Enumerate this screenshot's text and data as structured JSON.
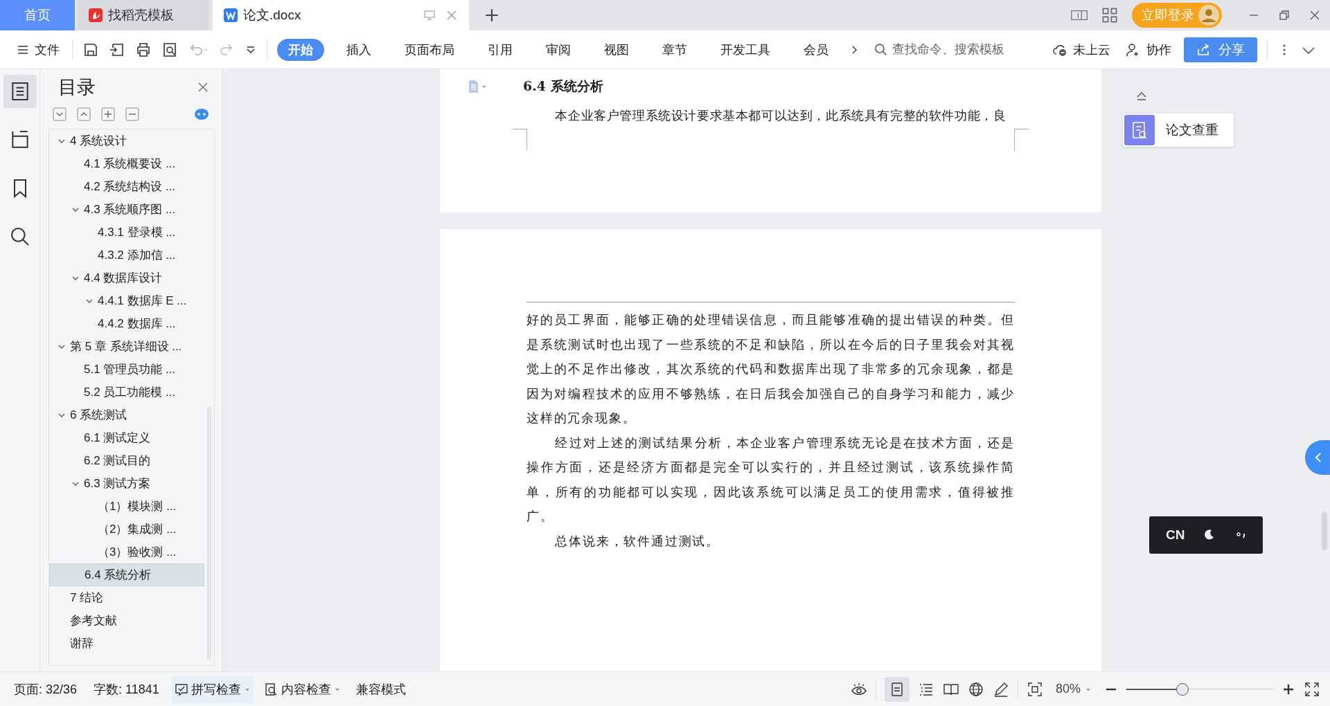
{
  "tabs": [
    {
      "label": "首页",
      "kind": "home",
      "selected": false
    },
    {
      "label": "找稻壳模板",
      "kind": "docer",
      "selected": false
    },
    {
      "label": "论文.docx",
      "kind": "doc",
      "selected": true
    }
  ],
  "account": {
    "login": "立即登录"
  },
  "toolbar": {
    "file_menu": "文件",
    "ribbon_tabs": [
      {
        "label": "开始",
        "selected": true
      },
      {
        "label": "插入",
        "selected": false
      },
      {
        "label": "页面布局",
        "selected": false
      },
      {
        "label": "引用",
        "selected": false
      },
      {
        "label": "审阅",
        "selected": false
      },
      {
        "label": "视图",
        "selected": false
      },
      {
        "label": "章节",
        "selected": false
      },
      {
        "label": "开发工具",
        "selected": false
      },
      {
        "label": "会员",
        "selected": false
      }
    ],
    "search": {
      "placeholder": "查找命令、搜索模板"
    },
    "cloud": "未上云",
    "collaborate": "协作",
    "share": "分享"
  },
  "sidebar": {
    "title": "目录",
    "outline": [
      {
        "label": "4  系统设计",
        "expanded": true,
        "selected": false,
        "children": [
          {
            "label": "4.1 系统概要设 ...",
            "selected": false
          },
          {
            "label": "4.2 系统结构设 ...",
            "selected": false
          },
          {
            "label": "4.3 系统顺序图 ...",
            "expanded": true,
            "selected": false,
            "children": [
              {
                "label": "4.3.1 登录模 ...",
                "selected": false
              },
              {
                "label": "4.3.2 添加信 ...",
                "selected": false
              }
            ]
          },
          {
            "label": "4.4 数据库设计",
            "expanded": true,
            "selected": false,
            "children": [
              {
                "label": "4.4.1 数据库 E ...",
                "expanded": true,
                "selected": false
              },
              {
                "label": "4.4.2 数据库 ...",
                "selected": false
              }
            ]
          }
        ]
      },
      {
        "label": "第 5 章  系统详细设 ...",
        "expanded": true,
        "selected": false,
        "children": [
          {
            "label": "5.1 管理员功能 ...",
            "selected": false
          },
          {
            "label": "5.2 员工功能模 ...",
            "selected": false
          }
        ]
      },
      {
        "label": "6  系统测试",
        "expanded": true,
        "selected": false,
        "children": [
          {
            "label": "6.1  测试定义",
            "selected": false
          },
          {
            "label": "6.2  测试目的",
            "selected": false
          },
          {
            "label": "6.3 测试方案",
            "expanded": true,
            "selected": false,
            "children": [
              {
                "label": "（1）模块测 ...",
                "selected": false
              },
              {
                "label": "（2）集成测 ...",
                "selected": false
              },
              {
                "label": "（3）验收测 ...",
                "selected": false
              }
            ]
          },
          {
            "label": "6.4 系统分析",
            "selected": true
          }
        ]
      },
      {
        "label": "7  结论",
        "selected": false
      },
      {
        "label": "参考文献",
        "selected": false
      },
      {
        "label": "谢辞",
        "selected": false
      }
    ]
  },
  "document": {
    "pages": [
      {
        "heading": "6.4 系统分析",
        "paragraphs": [
          {
            "indent": true,
            "text": "本企业客户管理系统设计要求基本都可以达到，此系统具有完整的软件功能，良"
          }
        ]
      },
      {
        "paragraphs": [
          {
            "indent": false,
            "text": "好的员工界面，能够正确的处理错误信息，而且能够准确的提出错误的种类。但是系统测试时也出现了一些系统的不足和缺陷，所以在今后的日子里我会对其视觉上的不足作出修改，其次系统的代码和数据库出现了非常多的冗余现象，都是因为对编程技术的应用不够熟练，在日后我会加强自己的自身学习和能力，减少这样的冗余现象。"
          },
          {
            "indent": true,
            "text": "经过对上述的测试结果分析，本企业客户管理系统无论是在技术方面，还是操作方面，还是经济方面都是完全可以实行的，并且经过测试，该系统操作简单，所有的功能都可以实现，因此该系统可以满足员工的使用需求，值得被推广。"
          },
          {
            "indent": true,
            "text": "总体说来，软件通过测试。"
          }
        ]
      }
    ]
  },
  "side_tools": {
    "plagiarism_check": "论文查重",
    "ime": "CN"
  },
  "status_bar": {
    "page": "页面: 32/36",
    "words": "字数: 11841",
    "spell_check": "拼写检查",
    "content_check": "内容检查",
    "compat": "兼容模式",
    "zoom": "80%",
    "zoom_slider": {
      "level": 0.38
    }
  }
}
